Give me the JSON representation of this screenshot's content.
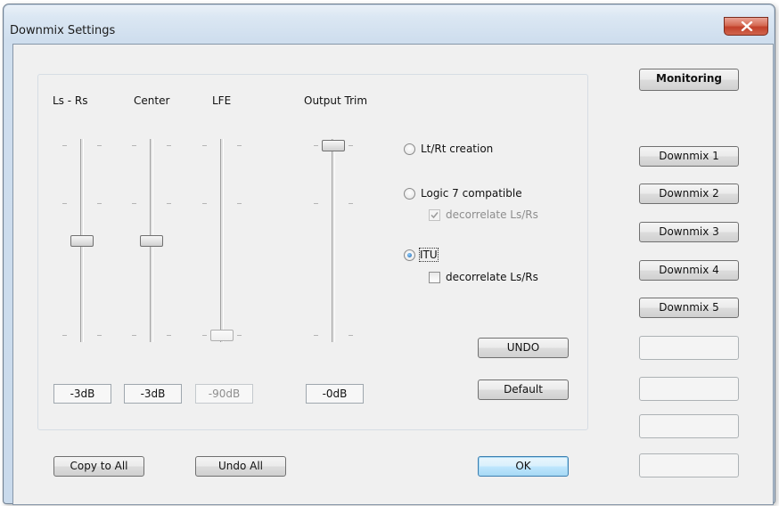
{
  "window": {
    "title": "Downmix Settings",
    "close_icon": "close-x-icon"
  },
  "sliders": [
    {
      "label": "Ls - Rs",
      "value": "-3dB",
      "level": 0.5,
      "disabled": false
    },
    {
      "label": "Center",
      "value": "-3dB",
      "level": 0.5,
      "disabled": false
    },
    {
      "label": "LFE",
      "value": "-90dB",
      "level": 0.0,
      "disabled": true
    },
    {
      "label": "Output Trim",
      "value": "-0dB",
      "level": 1.0,
      "disabled": false
    }
  ],
  "modes": {
    "lt_rt": {
      "label": "Lt/Rt creation",
      "checked": false
    },
    "logic7": {
      "label": "Logic 7 compatible",
      "checked": false,
      "decorrelate": {
        "label": "decorrelate Ls/Rs",
        "checked": true,
        "disabled": true
      }
    },
    "itu": {
      "label": "ITU",
      "checked": true,
      "decorrelate": {
        "label": "decorrelate Ls/Rs",
        "checked": false,
        "disabled": false
      }
    }
  },
  "buttons": {
    "undo": "UNDO",
    "default": "Default",
    "copy_to_all": "Copy to All",
    "undo_all": "Undo All",
    "ok": "OK",
    "monitoring": "Monitoring"
  },
  "presets": [
    "Downmix 1",
    "Downmix 2",
    "Downmix 3",
    "Downmix 4",
    "Downmix 5",
    "",
    "",
    "",
    ""
  ],
  "colors": {
    "accent": "#3c7fb1",
    "close": "#c2402a"
  }
}
